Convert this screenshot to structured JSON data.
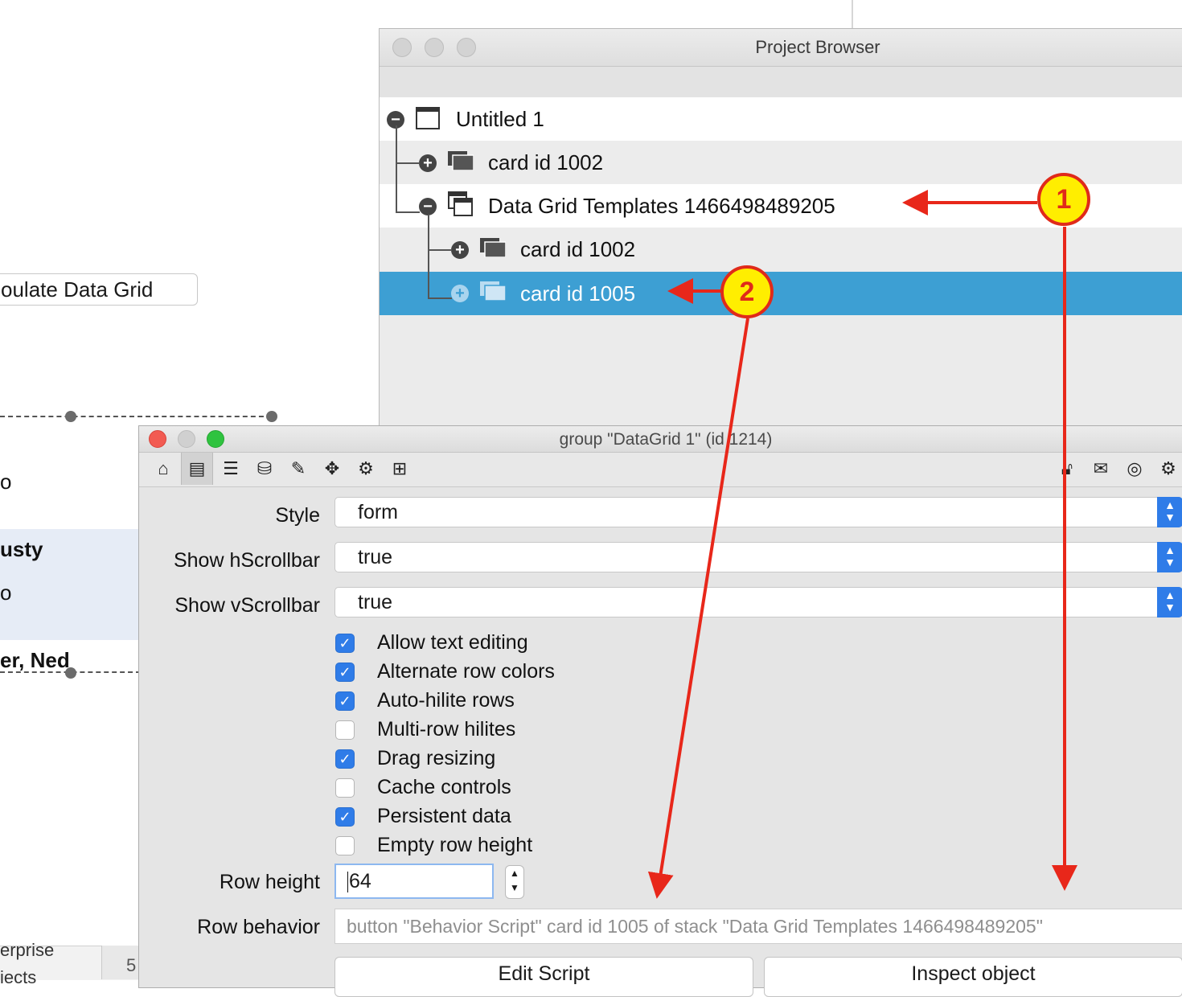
{
  "background": {
    "populate_button_label": "oulate Data Grid",
    "grid_rows": [
      {
        "text": "o"
      },
      {
        "text": "usty"
      },
      {
        "text": "o"
      },
      {
        "text": "er, Ned"
      }
    ],
    "footer_left": "erprise",
    "footer_left2": "iects",
    "footer_num": "5"
  },
  "project_browser": {
    "title": "Project Browser",
    "rows": [
      {
        "label": "Untitled 1"
      },
      {
        "label": "card id 1002"
      },
      {
        "label": "Data Grid Templates 1466498489205"
      },
      {
        "label": "card id 1002"
      },
      {
        "label": "card id 1005"
      }
    ]
  },
  "inspector": {
    "title": "group \"DataGrid 1\" (id 1214)",
    "toolbar_icons": [
      "home-icon",
      "basic-properties-icon",
      "list-icon",
      "database-icon",
      "pencil-icon",
      "move-icon",
      "gears-icon",
      "geometry-icon"
    ],
    "toolbar_right_icons": [
      "lock-icon",
      "message-icon",
      "target-icon",
      "gear-icon"
    ],
    "fields": {
      "style": {
        "label": "Style",
        "value": "form"
      },
      "hscroll": {
        "label": "Show hScrollbar",
        "value": "true"
      },
      "vscroll": {
        "label": "Show vScrollbar",
        "value": "true"
      }
    },
    "checkboxes": [
      {
        "label": "Allow text editing",
        "checked": true
      },
      {
        "label": "Alternate row colors",
        "checked": true
      },
      {
        "label": "Auto-hilite rows",
        "checked": true
      },
      {
        "label": "Multi-row hilites",
        "checked": false
      },
      {
        "label": "Drag resizing",
        "checked": true
      },
      {
        "label": "Cache controls",
        "checked": false
      },
      {
        "label": "Persistent data",
        "checked": true
      },
      {
        "label": "Empty row height",
        "checked": false
      }
    ],
    "row_height": {
      "label": "Row height",
      "value": "64"
    },
    "row_behavior": {
      "label": "Row behavior",
      "value": "button \"Behavior Script\" card  id 1005 of stack \"Data Grid Templates 1466498489205\""
    },
    "buttons": {
      "edit_script": "Edit Script",
      "inspect_object": "Inspect object"
    }
  },
  "annotations": {
    "callout_1": "1",
    "callout_2": "2",
    "arrow_color": "#e8271a"
  }
}
